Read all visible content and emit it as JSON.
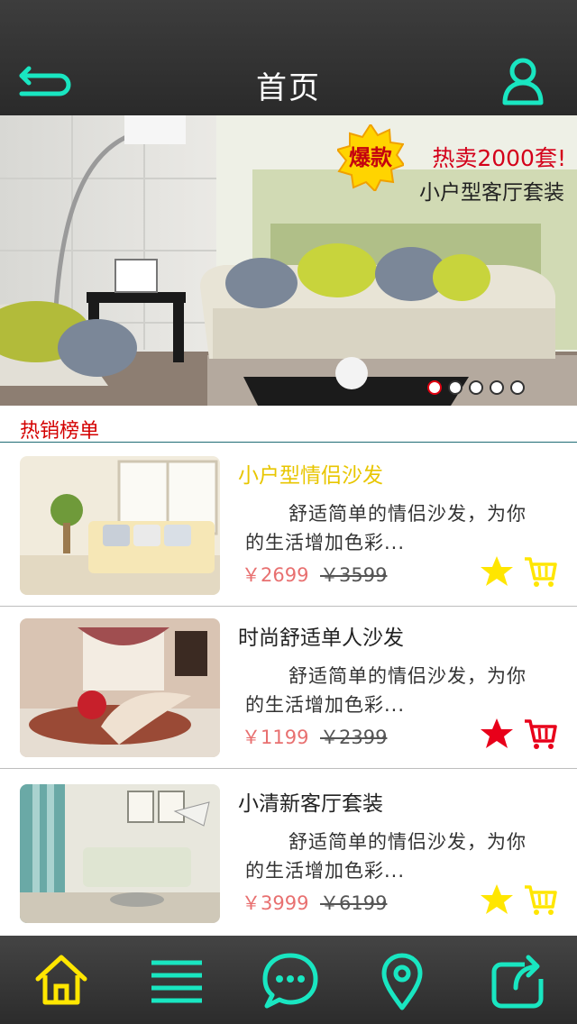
{
  "header": {
    "title": "首页",
    "back_icon": "back-arrow-icon",
    "user_icon": "user-icon"
  },
  "banner": {
    "badge": "爆款",
    "headline": "热卖2000套!",
    "subline": "小户型客厅套装",
    "slides": 5,
    "active_slide": 1
  },
  "section": {
    "title": "热销榜单"
  },
  "products": [
    {
      "name": "小户型情侣沙发",
      "desc": "舒适简单的情侣沙发，为你的生活增加色彩...",
      "price": "￥2699",
      "old_price": "￥3599",
      "favorited": false
    },
    {
      "name": "时尚舒适单人沙发",
      "desc": "舒适简单的情侣沙发，为你的生活增加色彩...",
      "price": "￥1199",
      "old_price": "￥2399",
      "favorited": true
    },
    {
      "name": "小清新客厅套装",
      "desc": "舒适简单的情侣沙发，为你的生活增加色彩...",
      "price": "￥3999",
      "old_price": "￥6199",
      "favorited": false
    }
  ],
  "tabs": [
    {
      "icon": "home-icon",
      "active": true
    },
    {
      "icon": "menu-icon",
      "active": false
    },
    {
      "icon": "chat-icon",
      "active": false
    },
    {
      "icon": "location-icon",
      "active": false
    },
    {
      "icon": "share-icon",
      "active": false
    }
  ],
  "colors": {
    "accent": "#19e6c1",
    "active": "#ffe600",
    "star": "#ffe600",
    "star_favorited": "#e8001a",
    "cart": "#ffe600",
    "cart_favorited": "#e8001a",
    "price": "#e87070"
  }
}
